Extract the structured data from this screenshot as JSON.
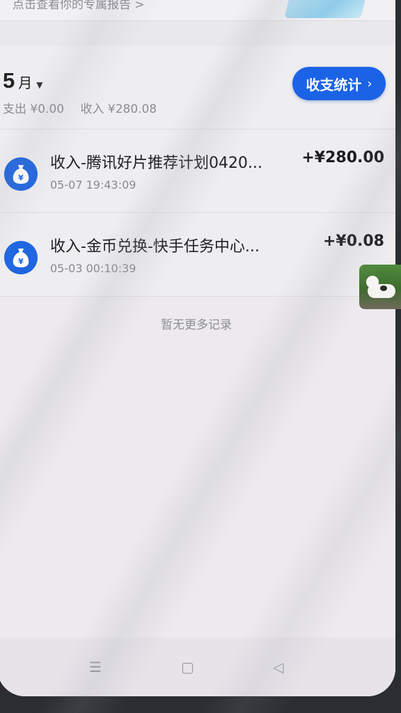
{
  "report_banner": {
    "text": "点击查看你的专属报告 >"
  },
  "summary": {
    "month_number": "5",
    "month_unit": "月",
    "expense_label": "支出 ¥0.00",
    "income_label": "收入 ¥280.08",
    "stats_button_label": "收支统计",
    "stats_button_chevron": "›"
  },
  "records": [
    {
      "icon": "money-bag-icon",
      "title": "收入-腾讯好片推荐计划0420...",
      "time": "05-07 19:43:09",
      "amount": "+¥280.00"
    },
    {
      "icon": "money-bag-icon",
      "title": "收入-金币兑换-快手任务中心...",
      "time": "05-03 00:10:39",
      "amount": "+¥0.08"
    }
  ],
  "empty_text": "暂无更多记录",
  "nav": {
    "menu": "☰",
    "home": "▢",
    "back": "◁"
  },
  "colors": {
    "accent": "#1b63e6",
    "background": "#eeedf0"
  }
}
